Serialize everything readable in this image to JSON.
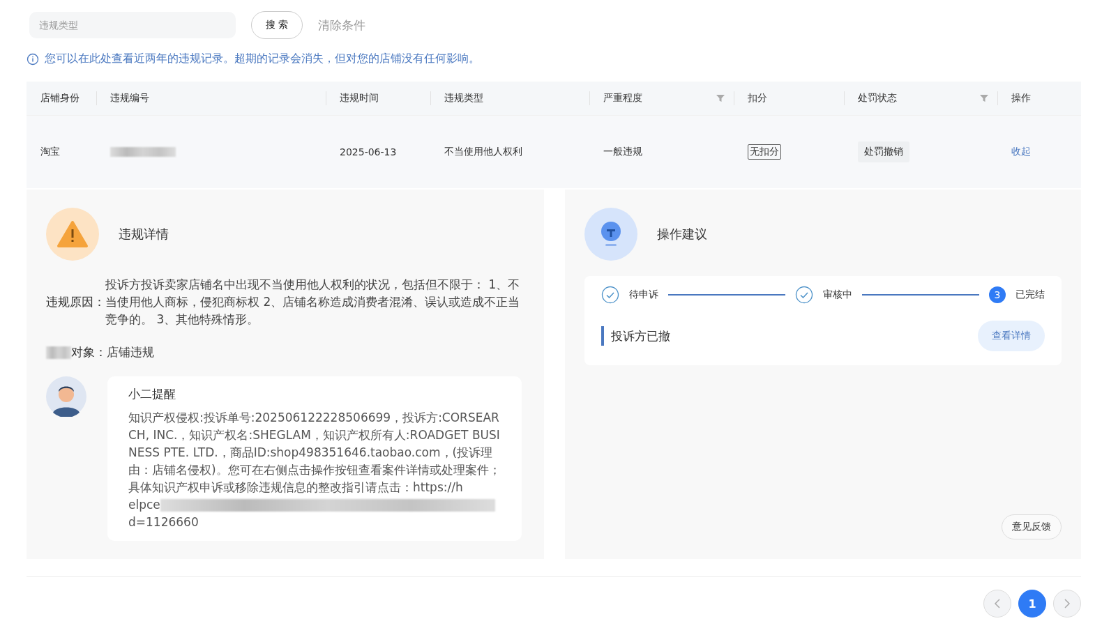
{
  "filter": {
    "placeholder": "违规类型",
    "search_button": "搜 索",
    "clear_link": "清除条件"
  },
  "notice": "您可以在此处查看近两年的违规记录。超期的记录会消失，但对您的店铺没有任何影响。",
  "table": {
    "columns": [
      {
        "label": "店铺身份",
        "filter": false
      },
      {
        "label": "违规编号",
        "filter": false
      },
      {
        "label": "违规时间",
        "filter": false
      },
      {
        "label": "违规类型",
        "filter": false
      },
      {
        "label": "严重程度",
        "filter": true
      },
      {
        "label": "扣分",
        "filter": false
      },
      {
        "label": "处罚状态",
        "filter": true
      },
      {
        "label": "操作",
        "filter": false
      }
    ],
    "rows": [
      {
        "shop": "淘宝",
        "id_redacted": true,
        "time": "2025-06-13",
        "type": "不当使用他人权利",
        "severity": "一般违规",
        "points": "无扣分",
        "status": "处罚撤销",
        "action": "收起",
        "expanded": true
      }
    ]
  },
  "detail": {
    "title": "违规详情",
    "fields": [
      {
        "label": "违规原因：",
        "value": "投诉方投诉卖家店铺名中出现不当使用他人权利的状况，包括但不限于： 1、不当使用他人商标，侵犯商标权 2、店铺名称造成消费者混淆、误认或造成不正当竞争的。 3、其他特殊情形。",
        "label_redacted": false
      },
      {
        "label": "对象：",
        "value": "店铺违规",
        "label_redacted": true
      }
    ],
    "reminder": {
      "title": "小二提醒",
      "text": "知识产权侵权:投诉单号:202506122228506699，投诉方:CORSEARCH, INC.，知识产权名:SHEGLAM，知识产权所有人:ROADGET BUSINESS PTE. LTD.，商品ID:shop498351646.taobao.com，(投诉理由：店铺名侵权)。您可在右侧点击操作按钮查看案件详情或处理案件；具体知识产权申诉或移除违规信息的整改指引请点击：https://h",
      "link_start": "elpce",
      "link_end": "d=1126660"
    }
  },
  "advice": {
    "title": "操作建议",
    "steps": [
      {
        "label": "待申诉",
        "done": true
      },
      {
        "label": "审核中",
        "done": true
      },
      {
        "label": "已完结",
        "number": "3",
        "done": false
      }
    ],
    "result": "投诉方已撤",
    "details_button": "查看详情",
    "feedback_button": "意见反馈"
  },
  "pagination": {
    "pages": [
      {
        "label": "1",
        "selected": true
      }
    ]
  }
}
